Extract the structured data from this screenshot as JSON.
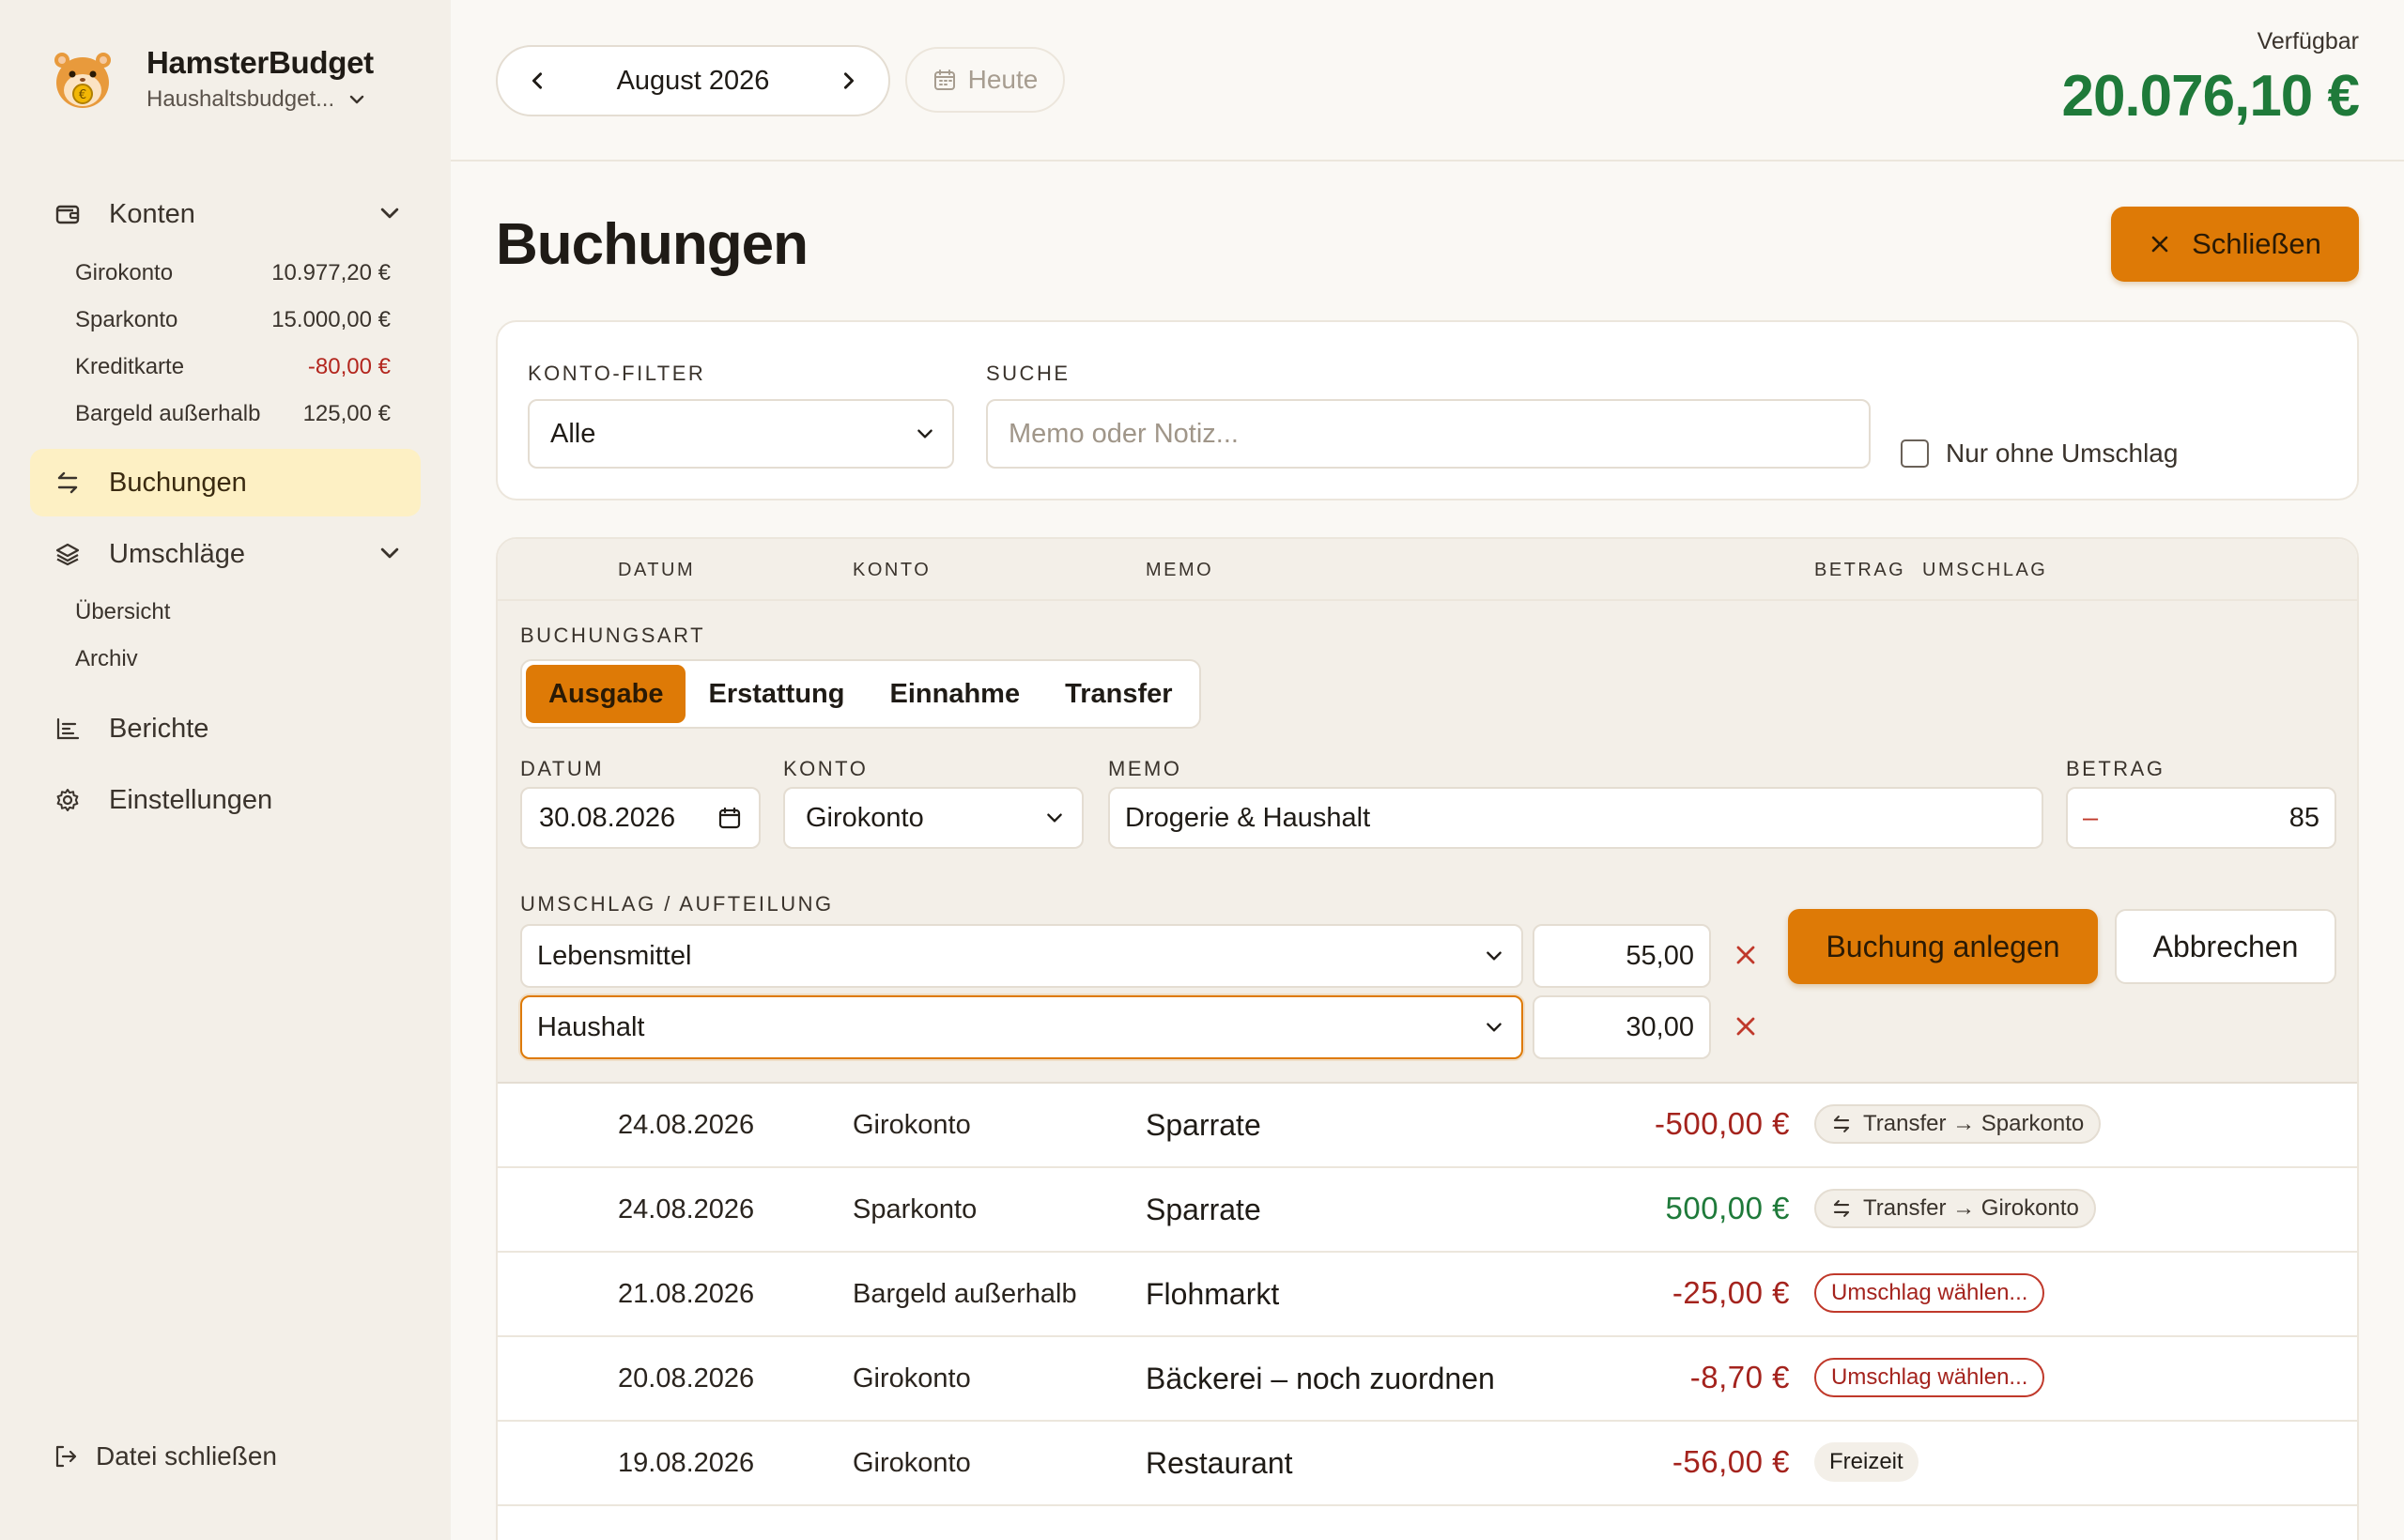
{
  "brand": {
    "title": "HamsterBudget",
    "subtitle": "Haushaltsbudget..."
  },
  "sidebar": {
    "accounts_label": "Konten",
    "accounts": [
      {
        "name": "Girokonto",
        "balance": "10.977,20 €",
        "negative": false
      },
      {
        "name": "Sparkonto",
        "balance": "15.000,00 €",
        "negative": false
      },
      {
        "name": "Kreditkarte",
        "balance": "-80,00 €",
        "negative": true
      },
      {
        "name": "Bargeld außerhalb",
        "balance": "125,00 €",
        "negative": false
      }
    ],
    "bookings_label": "Buchungen",
    "envelopes_label": "Umschläge",
    "envelope_links": [
      "Übersicht",
      "Archiv"
    ],
    "reports_label": "Berichte",
    "settings_label": "Einstellungen",
    "logout_label": "Datei schließen"
  },
  "topbar": {
    "month": "August 2026",
    "today": "Heute",
    "available_label": "Verfügbar",
    "available_amount": "20.076,10 €"
  },
  "page": {
    "title": "Buchungen",
    "close_label": "Schließen"
  },
  "filters": {
    "account_label": "KONTO-FILTER",
    "account_value": "Alle",
    "search_label": "SUCHE",
    "search_placeholder": "Memo oder Notiz...",
    "no_envelope_label": "Nur ohne Umschlag"
  },
  "table": {
    "headers": {
      "date": "DATUM",
      "account": "KONTO",
      "memo": "MEMO",
      "amount": "BETRAG",
      "envelope": "UMSCHLAG"
    },
    "rows": [
      {
        "date": "24.08.2026",
        "account": "Girokonto",
        "memo": "Sparrate",
        "amount": "-500,00 €",
        "sign": "neg",
        "tag_type": "transfer",
        "tag": "Transfer → Sparkonto"
      },
      {
        "date": "24.08.2026",
        "account": "Sparkonto",
        "memo": "Sparrate",
        "amount": "500,00 €",
        "sign": "pos",
        "tag_type": "transfer",
        "tag": "Transfer → Girokonto"
      },
      {
        "date": "21.08.2026",
        "account": "Bargeld außerhalb",
        "memo": "Flohmarkt",
        "amount": "-25,00 €",
        "sign": "neg",
        "tag_type": "choose",
        "tag": "Umschlag wählen..."
      },
      {
        "date": "20.08.2026",
        "account": "Girokonto",
        "memo": "Bäckerei – noch zuordnen",
        "amount": "-8,70 €",
        "sign": "neg",
        "tag_type": "choose",
        "tag": "Umschlag wählen..."
      },
      {
        "date": "19.08.2026",
        "account": "Girokonto",
        "memo": "Restaurant",
        "amount": "-56,00 €",
        "sign": "neg",
        "tag_type": "plain",
        "tag": "Freizeit"
      }
    ]
  },
  "editor": {
    "type_label": "BUCHUNGSART",
    "types": [
      "Ausgabe",
      "Erstattung",
      "Einnahme",
      "Transfer"
    ],
    "active_type": "Ausgabe",
    "date_label": "DATUM",
    "date_value": "30.08.2026",
    "account_label": "KONTO",
    "account_value": "Girokonto",
    "memo_label": "MEMO",
    "memo_value": "Drogerie & Haushalt",
    "amount_label": "BETRAG",
    "amount_sign": "–",
    "amount_value": "85",
    "split_label": "UMSCHLAG / AUFTEILUNG",
    "splits": [
      {
        "envelope": "Lebensmittel",
        "amount": "55,00"
      },
      {
        "envelope": "Haushalt",
        "amount": "30,00"
      }
    ],
    "create_label": "Buchung anlegen",
    "cancel_label": "Abbrechen"
  },
  "colors": {
    "accent": "#de7a06",
    "positive": "#1f7a3a",
    "negative": "#a4231d",
    "active_nav": "#fdf0c4"
  }
}
